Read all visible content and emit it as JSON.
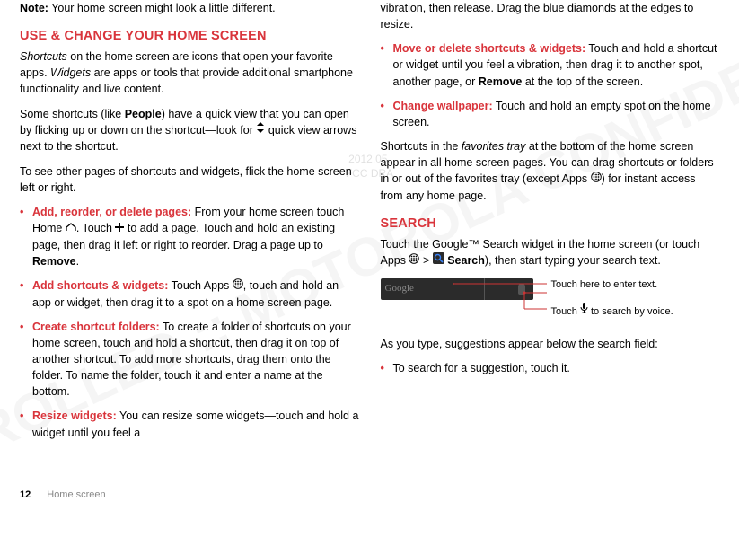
{
  "note": {
    "label": "Note:",
    "text": "Your home screen might look a little different."
  },
  "section1": {
    "title": "USE & CHANGE YOUR HOME SCREEN",
    "p1a": "Shortcuts",
    "p1b": " on the home screen are icons that open your favorite apps. ",
    "p1c": "Widgets",
    "p1d": " are apps or tools that provide additional smartphone functionality and live content.",
    "p2a": "Some shortcuts (like ",
    "p2b": "People",
    "p2c": ") have a quick view that you can open by flicking up or down on the shortcut—look for ",
    "p2d": " quick view arrows next to the shortcut.",
    "p3": "To see other pages of shortcuts and widgets, flick the home screen left or right.",
    "li1": {
      "title": "Add, reorder, or delete pages:",
      "a": " From your home screen touch Home ",
      "b": ". Touch ",
      "c": " to add a page. Touch and hold an existing page, then drag it left or right to reorder. Drag a page up to ",
      "d": "Remove",
      "e": "."
    },
    "li2": {
      "title": "Add shortcuts & widgets:",
      "a": " Touch Apps ",
      "b": ", touch and hold an app or widget, then drag it to a spot on a home screen page."
    },
    "li3": {
      "title": "Create shortcut folders:",
      "a": " To create a folder of shortcuts on your home screen, touch and hold a shortcut, then drag it on top of another shortcut. To add more shortcuts, drag them onto the folder. To name the folder, touch it and enter a name at the bottom."
    },
    "li4": {
      "title": "Resize widgets:",
      "a": " You can resize some widgets—touch and hold a widget until you feel a "
    }
  },
  "col2": {
    "p_cont": "vibration, then release. Drag the blue diamonds at the edges to resize.",
    "li5": {
      "title": "Move or delete shortcuts & widgets:",
      "a": " Touch and hold a shortcut or widget until you feel a vibration, then drag it to another spot, another page, or ",
      "b": "Remove",
      "c": " at the top of the screen."
    },
    "li6": {
      "title": "Change wallpaper:",
      "a": " Touch and hold an empty spot on the home screen."
    },
    "p_fav_a": "Shortcuts in the ",
    "p_fav_b": "favorites tray",
    "p_fav_c": " at the bottom of the home screen appear in all home screen pages. You can drag shortcuts or folders in or out of the favorites tray (except Apps ",
    "p_fav_d": ") for instant access from any home page."
  },
  "search": {
    "title": "SEARCH",
    "p1a": "Touch the Google™ Search widget in the home screen (or touch Apps ",
    "p1b": " > ",
    "p1c": "Search",
    "p1d": "), then start typing your search text.",
    "google": "Google",
    "callout1": "Touch here to enter text.",
    "callout2a": "Touch ",
    "callout2b": " to search by voice.",
    "p2": "As you type, suggestions appear below the search field:",
    "li1": "To search for a suggestion, touch it."
  },
  "draft": {
    "date": "2012.05.",
    "label": "FCC DRA"
  },
  "footer": {
    "page": "12",
    "section": "Home screen"
  }
}
